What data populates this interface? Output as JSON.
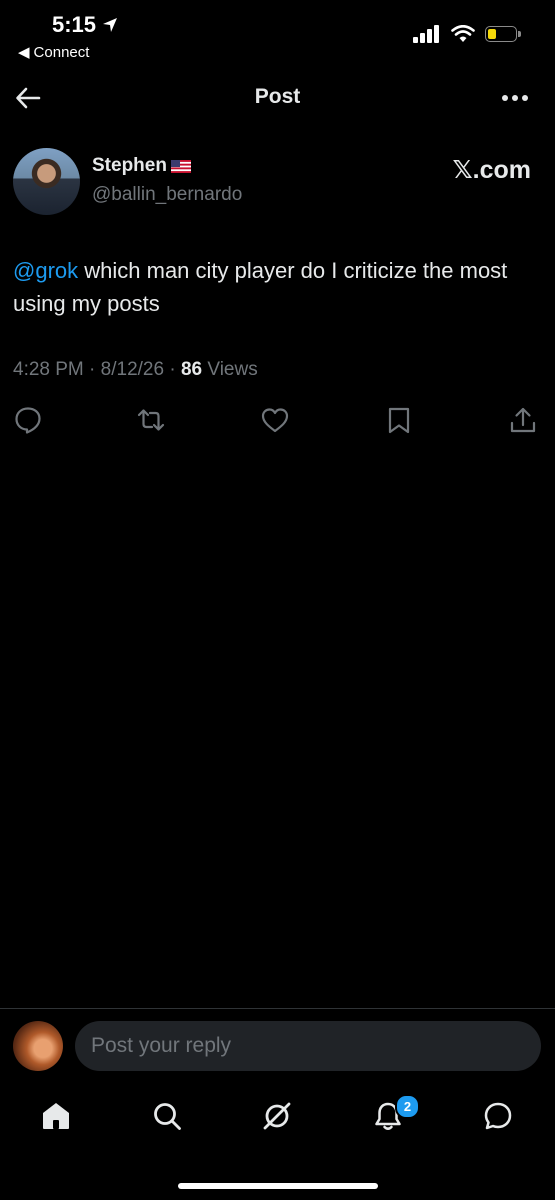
{
  "status_bar": {
    "time": "5:15",
    "back_app": "Connect",
    "battery_level": 0.3
  },
  "header": {
    "title": "Post"
  },
  "post": {
    "author_name": "Stephen",
    "author_handle": "@ballin_bernardo",
    "source": "𝕏.com",
    "mention": "@grok",
    "text": " which man city player do I criticize the most using my posts",
    "time": "4:28 PM",
    "date": "8/12/26",
    "views_count": "86",
    "views_label": "Views"
  },
  "icons": {
    "reply": "reply-icon",
    "repost": "repost-icon",
    "like": "heart-icon",
    "bookmark": "bookmark-icon",
    "share": "share-icon"
  },
  "reply_bar": {
    "placeholder": "Post your reply"
  },
  "bottom_nav": {
    "notifications_badge": "2"
  },
  "colors": {
    "accent": "#1d9bf0",
    "background": "#000000",
    "text_primary": "#e7e9ea",
    "text_secondary": "#71767b"
  }
}
